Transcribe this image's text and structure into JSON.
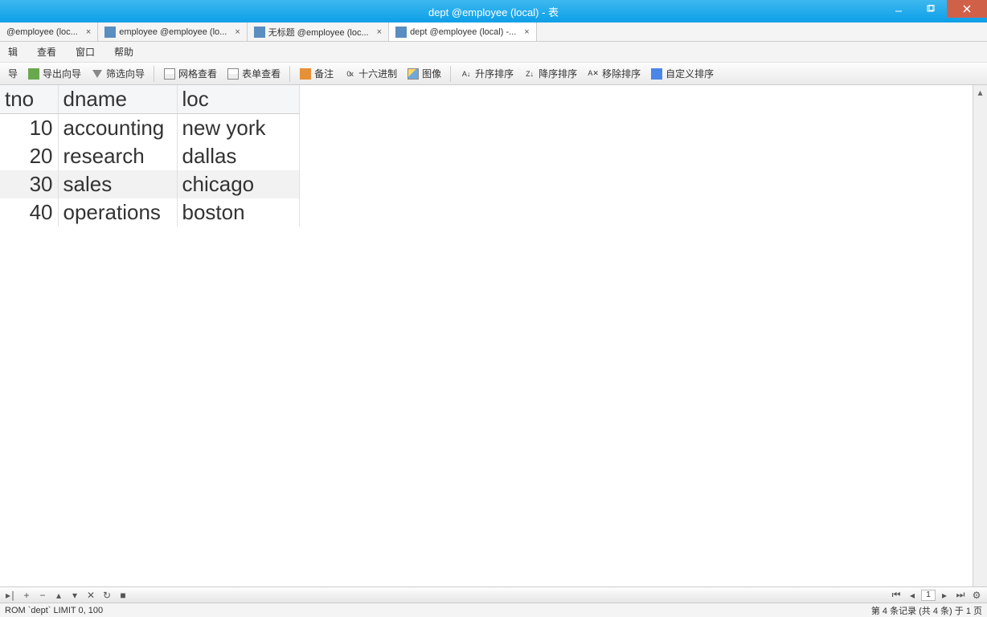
{
  "window_title": "dept @employee (local) - 表",
  "tabs": [
    {
      "label": "@employee (loc...",
      "active": false
    },
    {
      "label": "employee @employee (lo...",
      "active": false
    },
    {
      "label": "无标题 @employee (loc...",
      "active": false
    },
    {
      "label": "dept @employee (local) -...",
      "active": true
    }
  ],
  "menu": {
    "edit": "辑",
    "view": "查看",
    "window": "窗口",
    "help": "帮助"
  },
  "toolbar": {
    "export_wizard": "导出向导",
    "filter_wizard": "筛选向导",
    "grid_view": "网格查看",
    "form_view": "表单查看",
    "remark": "备注",
    "hex": "十六进制",
    "image": "图像",
    "asc": "升序排序",
    "desc": "降序排序",
    "remove_sort": "移除排序",
    "custom_sort": "自定义排序",
    "leading_btn": "导"
  },
  "table": {
    "columns": [
      "tno",
      "dname",
      "loc"
    ],
    "rows": [
      {
        "tno": "10",
        "dname": "accounting",
        "loc": "new york"
      },
      {
        "tno": "20",
        "dname": "research",
        "loc": "dallas"
      },
      {
        "tno": "30",
        "dname": "sales",
        "loc": "chicago"
      },
      {
        "tno": "40",
        "dname": "operations",
        "loc": "boston"
      }
    ]
  },
  "nav_page": "1",
  "status": {
    "sql": "ROM `dept` LIMIT 0, 100",
    "info": "第 4 条记录 (共 4 条) 于 1 页"
  }
}
